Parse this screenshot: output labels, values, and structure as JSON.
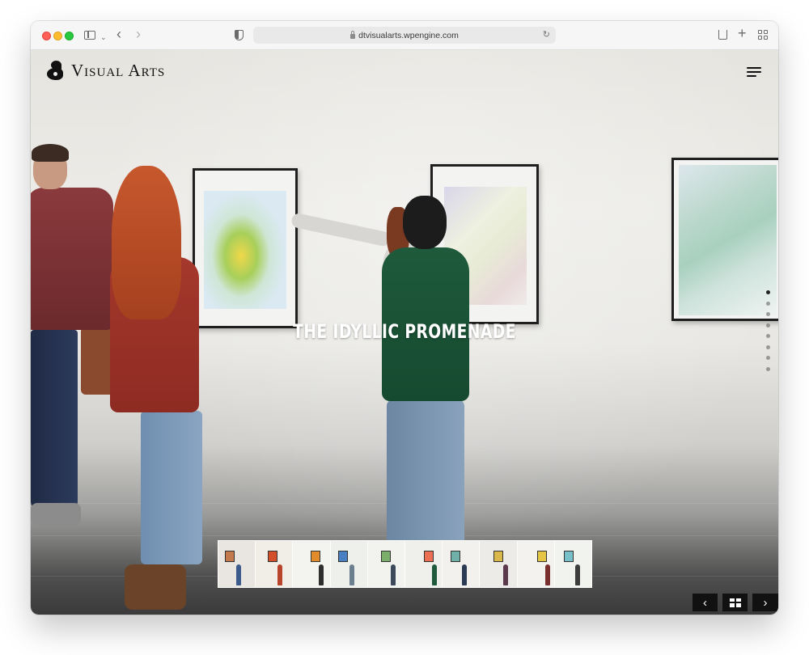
{
  "browser": {
    "url": "dtvisualarts.wpengine.com",
    "icons": [
      "sidebar-icon",
      "chevron-down-icon",
      "back-icon",
      "forward-icon",
      "shield-icon",
      "lock-icon",
      "reload-icon",
      "share-icon",
      "new-tab-icon",
      "tab-overview-icon"
    ],
    "glyphs": {
      "back": "‹",
      "forward": "›",
      "chevron": "⌄",
      "reload": "↻",
      "plus": "+"
    }
  },
  "site": {
    "brand": "Visual Arts",
    "menu_icon": "hamburger-icon"
  },
  "hero": {
    "title": "THE IDYLLIC PROMENADE",
    "slide_count": 8,
    "active_slide": 1
  },
  "thumbnails": [
    {
      "tone": "#e9e6e2",
      "accent": "#c47a4f",
      "fig": "#3c5a8c"
    },
    {
      "tone": "#f1ede7",
      "accent": "#d4502b",
      "fig": "#b9442d"
    },
    {
      "tone": "#f3f3f0",
      "accent": "#e28b2a",
      "fig": "#2e2e2e"
    },
    {
      "tone": "#eef0ec",
      "accent": "#4a7fc1",
      "fig": "#6c7f8f"
    },
    {
      "tone": "#f2f2ef",
      "accent": "#7cae6b",
      "fig": "#3c4a5c"
    },
    {
      "tone": "#efefec",
      "accent": "#ec6f54",
      "fig": "#1e5a3b"
    },
    {
      "tone": "#f3f1ee",
      "accent": "#6fb0a8",
      "fig": "#2b3b55"
    },
    {
      "tone": "#ecebe7",
      "accent": "#d8b74b",
      "fig": "#5a3a4b"
    },
    {
      "tone": "#f4f2ee",
      "accent": "#e6c544",
      "fig": "#7a2f2f"
    },
    {
      "tone": "#f1f3ee",
      "accent": "#78c0c9",
      "fig": "#3d3d3d"
    }
  ],
  "controls": {
    "prev_glyph": "‹",
    "next_glyph": "›"
  },
  "colors": {
    "traffic_close": "#ff5f57",
    "traffic_min": "#febc2e",
    "traffic_max": "#28c840",
    "hero_text": "#ffffff",
    "control_bg": "#111111"
  }
}
